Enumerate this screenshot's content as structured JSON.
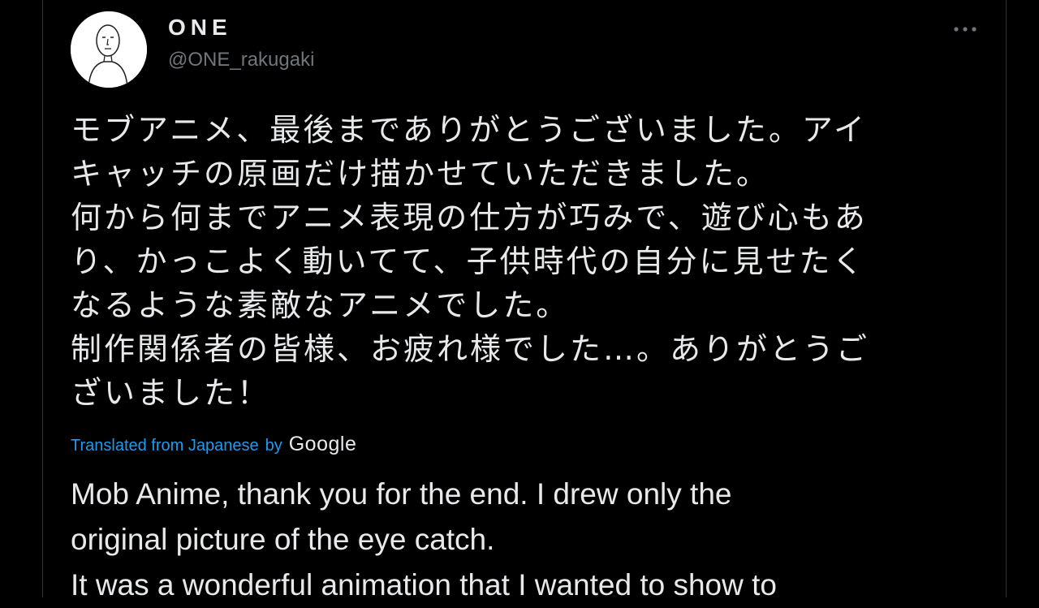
{
  "author": {
    "name": "ONE",
    "handle": "@ONE_rakugaki"
  },
  "icons": {
    "avatar": "caricature-avatar",
    "more": "more-options-icon"
  },
  "tweet": {
    "original_text": "モブアニメ、最後までありがとうございました。アイ\nキャッチの原画だけ描かせていただきました。\n何から何までアニメ表現の仕方が巧みで、遊び心もあ\nり、かっこよく動いてて、子供時代の自分に見せたく\nなるような素敵なアニメでした。\n制作関係者の皆様、お疲れ様でした…。ありがとうご\nざいました！",
    "translated_from_label": "Translated from Japanese",
    "translated_by_label": "by",
    "translator": "Google",
    "translation_text": "Mob Anime, thank you for the end. I drew only the\noriginal picture of the eye catch.\nIt was a wonderful animation that I wanted to show to"
  },
  "colors": {
    "background": "#000000",
    "text_primary": "#e7e9ea",
    "text_secondary": "#71767b",
    "accent": "#1d9bf0",
    "border": "#2f3336"
  }
}
